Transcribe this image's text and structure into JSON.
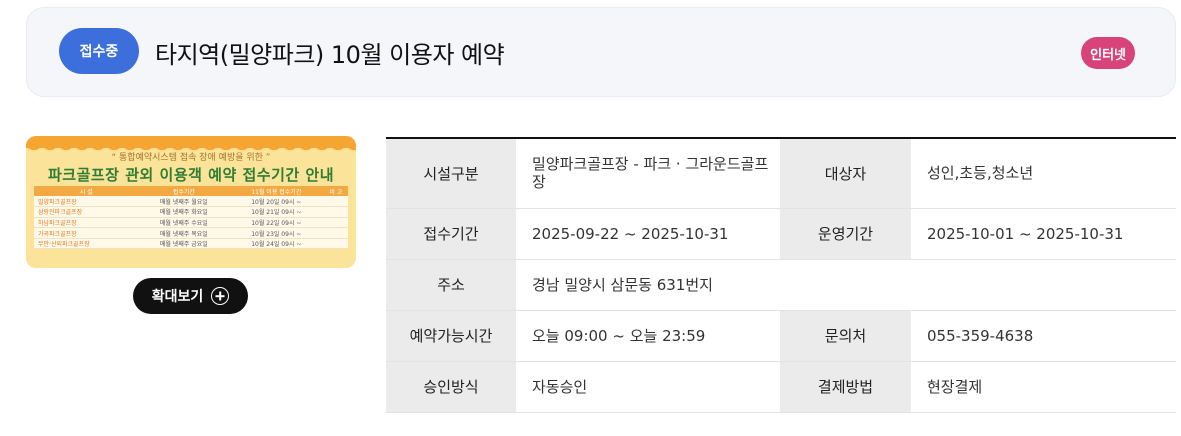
{
  "header": {
    "status": "접수중",
    "title": "타지역(밀양파크) 10월 이용자 예약",
    "channel": "인터넷"
  },
  "poster": {
    "subtitle": "“ 통합예약시스템 접속 장애 예방을 위한 ”",
    "title": "파크골프장 관외 이용객 예약 접수기간 안내",
    "columns": [
      "시 설",
      "접수기간",
      "11월 이용 접수기간",
      "비 고"
    ],
    "rows": [
      [
        "밀양파크골프장",
        "매월 넷째주 월요일",
        "10월 20일 09시 ~",
        ""
      ],
      [
        "삼랑진파크골프장",
        "매월 넷째주 화요일",
        "10월 21일 09시 ~",
        ""
      ],
      [
        "하남파크골프장",
        "매월 넷째주 수요일",
        "10월 22일 09시 ~",
        ""
      ],
      [
        "가곡파크골프장",
        "매월 넷째주 목요일",
        "10월 23일 09시 ~",
        ""
      ],
      [
        "무안·산외파크골프장",
        "매월 넷째주 금요일",
        "10월 24일 09시 ~",
        ""
      ]
    ]
  },
  "zoom_label": "확대보기",
  "details": {
    "facility_label": "시설구분",
    "facility_value": "밀양파크골프장 - 파크 · 그라운드골프장",
    "target_label": "대상자",
    "target_value": "성인,초등,청소년",
    "reception_label": "접수기간",
    "reception_value": "2025-09-22 ~ 2025-10-31",
    "operation_label": "운영기간",
    "operation_value": "2025-10-01 ~ 2025-10-31",
    "address_label": "주소",
    "address_value": "경남 밀양시 삼문동 631번지",
    "time_label": "예약가능시간",
    "time_value": "오늘 09:00 ~ 오늘 23:59",
    "contact_label": "문의처",
    "contact_value": "055-359-4638",
    "approval_label": "승인방식",
    "approval_value": "자동승인",
    "payment_label": "결제방법",
    "payment_value": "현장결제"
  }
}
